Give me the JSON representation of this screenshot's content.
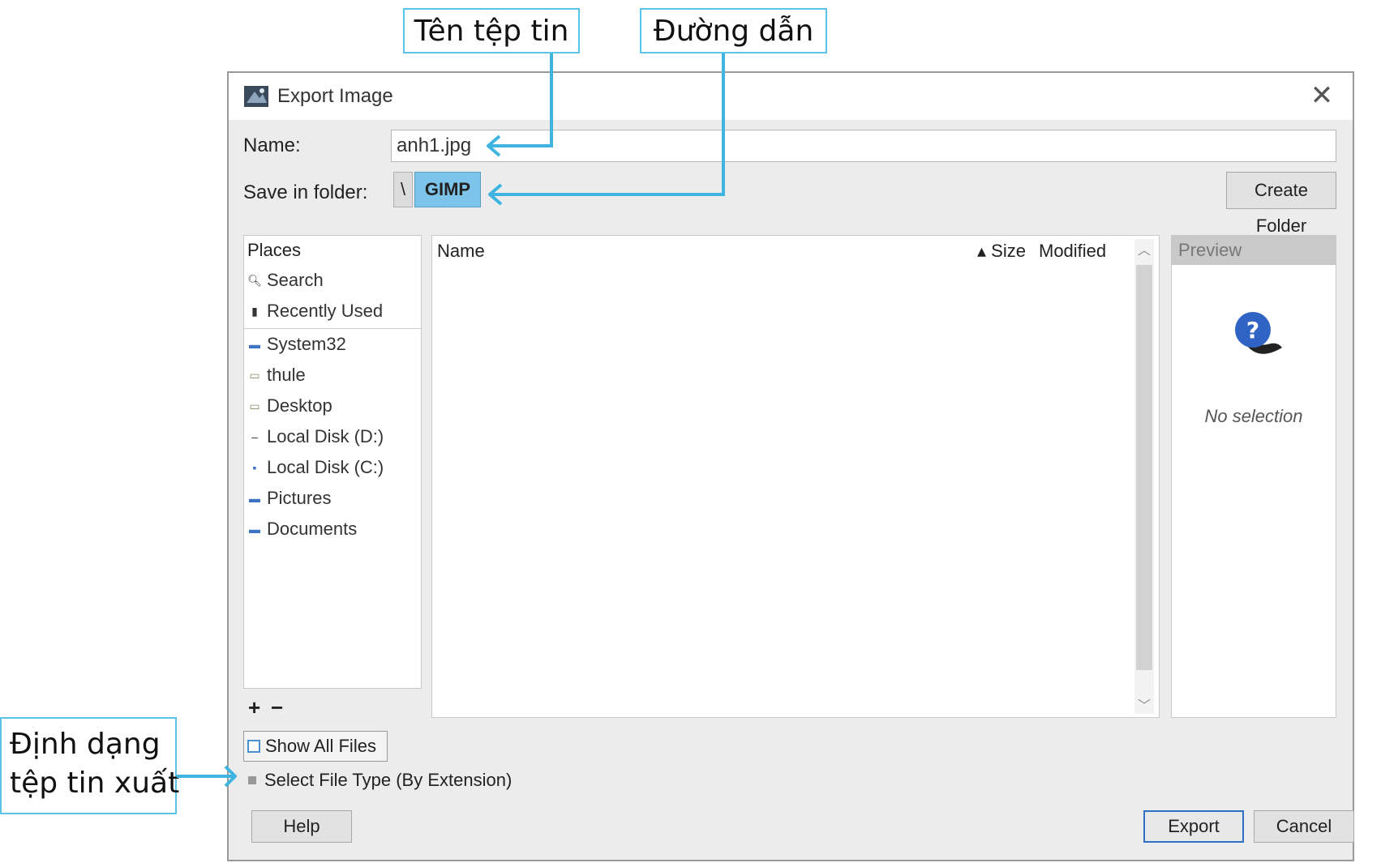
{
  "callouts": {
    "filename": "Tên tệp tin",
    "path": "Đường dẫn",
    "format": "Định dạng\ntệp tin xuất"
  },
  "dialog": {
    "title": "Export Image",
    "close_glyph": "✕",
    "name_label": "Name:",
    "name_value": "anh1.jpg",
    "folder_label": "Save in folder:",
    "path_root": "\\",
    "path_current": "GIMP",
    "create_folder": "Create Folder"
  },
  "places": {
    "header": "Places",
    "items": [
      {
        "label": "Search",
        "icon": "search-icon"
      },
      {
        "label": "Recently Used",
        "icon": "recent-icon"
      },
      {
        "label": "System32",
        "icon": "folder-icon"
      },
      {
        "label": "thule",
        "icon": "folder-icon"
      },
      {
        "label": "Desktop",
        "icon": "folder-icon"
      },
      {
        "label": "Local Disk (D:)",
        "icon": "drive-icon"
      },
      {
        "label": "Local Disk (C:)",
        "icon": "drive-icon"
      },
      {
        "label": "Pictures",
        "icon": "folder-icon"
      },
      {
        "label": "Documents",
        "icon": "folder-icon"
      }
    ],
    "add": "+",
    "remove": "−"
  },
  "filelist": {
    "col_name": "Name",
    "col_size": "▴ Size",
    "col_modified": "Modified"
  },
  "preview": {
    "header": "Preview",
    "empty_text": "No selection"
  },
  "options": {
    "show_all_files": "Show All Files",
    "select_file_type": "Select File Type (By Extension)"
  },
  "buttons": {
    "help": "Help",
    "export": "Export",
    "cancel": "Cancel"
  },
  "colors": {
    "callout_border": "#5bc3e6",
    "arrow": "#3fb4e0",
    "path_highlight": "#7cc4ea"
  }
}
